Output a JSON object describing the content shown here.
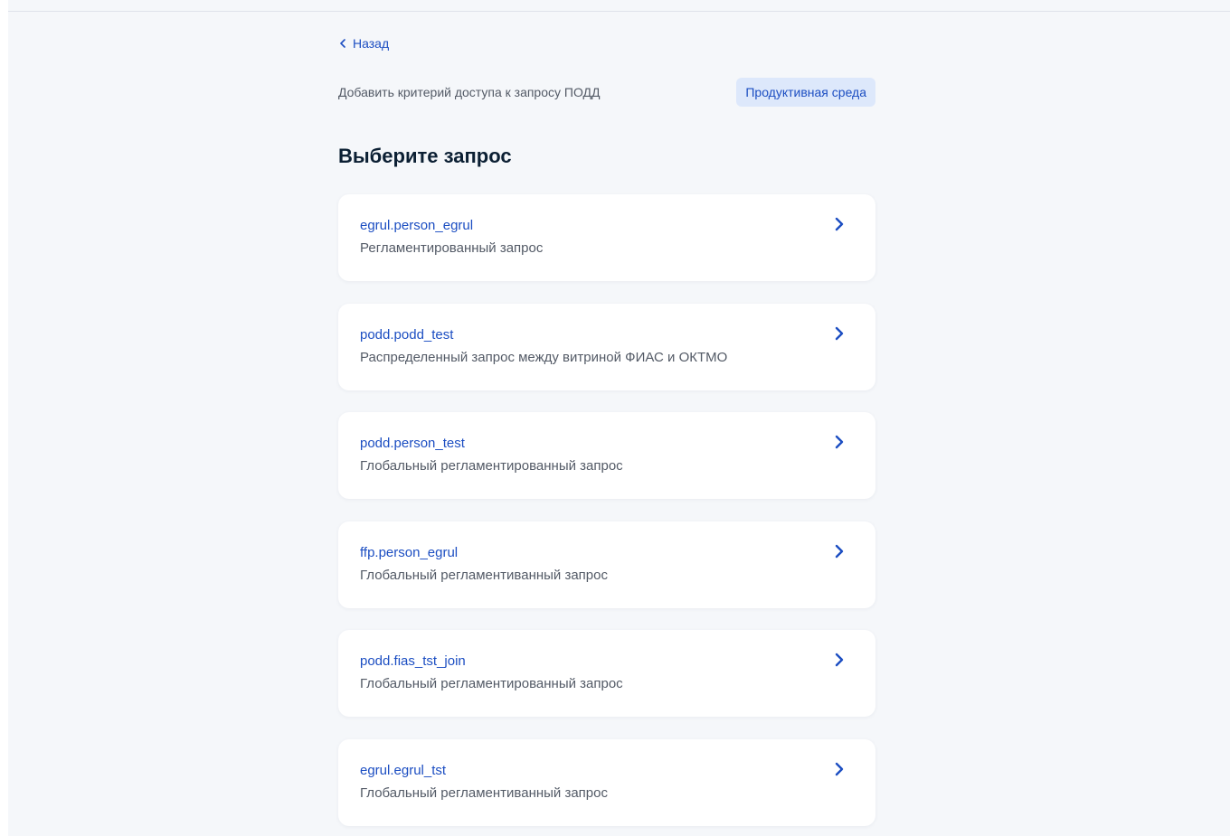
{
  "nav": {
    "back_label": "Назад"
  },
  "header": {
    "subtitle": "Добавить критерий доступа к запросу ПОДД",
    "env_badge": "Продуктивная среда"
  },
  "page_title": "Выберите запрос",
  "requests": [
    {
      "name": "egrul.person_egrul",
      "description": "Регламентированный запрос"
    },
    {
      "name": "podd.podd_test",
      "description": "Распределенный запрос между витриной ФИАС и ОКТМО"
    },
    {
      "name": "podd.person_test",
      "description": "Глобальный регламентированный запрос"
    },
    {
      "name": "ffp.person_egrul",
      "description": "Глобальный регламентиванный запрос"
    },
    {
      "name": "podd.fias_tst_join",
      "description": "Глобальный регламентированный запрос"
    },
    {
      "name": "egrul.egrul_tst",
      "description": "Глобальный регламентиванный запрос"
    }
  ],
  "icons": {
    "back": "chevron-left-icon",
    "item_arrow": "chevron-right-icon"
  },
  "colors": {
    "accent": "#1c4ec2",
    "badge_bg": "#dde8fb",
    "page_bg": "#f5f7fa",
    "title": "#0b1f33",
    "muted_text": "#535a66"
  }
}
